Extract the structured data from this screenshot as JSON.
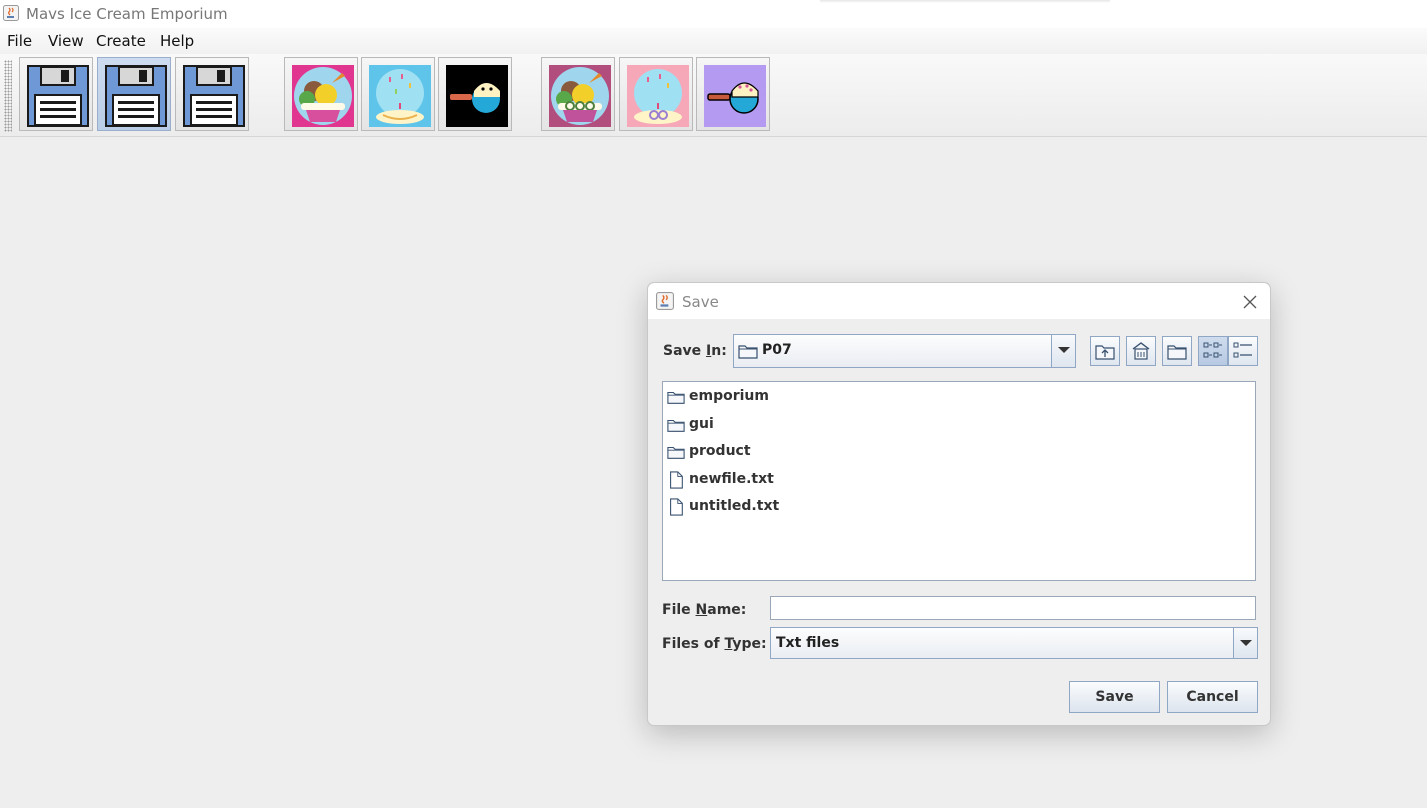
{
  "app": {
    "title": "Mavs Ice Cream Emporium"
  },
  "menubar": {
    "items": [
      "File",
      "View",
      "Create",
      "Help"
    ]
  },
  "toolbar": {
    "buttons": [
      {
        "icon": "save-icon"
      },
      {
        "icon": "save-as-icon"
      },
      {
        "icon": "save-all-icon"
      },
      {
        "icon": "create-serving-icon"
      },
      {
        "icon": "create-flavor-icon"
      },
      {
        "icon": "create-container-icon"
      },
      {
        "icon": "view-servings-icon"
      },
      {
        "icon": "view-flavors-icon"
      },
      {
        "icon": "view-containers-icon"
      }
    ]
  },
  "dialog": {
    "title": "Save",
    "save_in_label_prefix": "Save ",
    "save_in_label_mnemonic": "I",
    "save_in_label_suffix": "n:",
    "save_in_value": "P07",
    "files": [
      {
        "name": "emporium",
        "type": "folder"
      },
      {
        "name": "gui",
        "type": "folder"
      },
      {
        "name": "product",
        "type": "folder"
      },
      {
        "name": "newfile.txt",
        "type": "file"
      },
      {
        "name": "untitled.txt",
        "type": "file"
      }
    ],
    "file_name_label_prefix": "File ",
    "file_name_label_mnemonic": "N",
    "file_name_label_suffix": "ame:",
    "file_name_value": "",
    "files_of_type_label_prefix": "Files of ",
    "files_of_type_label_mnemonic": "T",
    "files_of_type_label_suffix": "ype:",
    "files_of_type_value": "Txt files",
    "save_button": "Save",
    "cancel_button": "Cancel"
  }
}
